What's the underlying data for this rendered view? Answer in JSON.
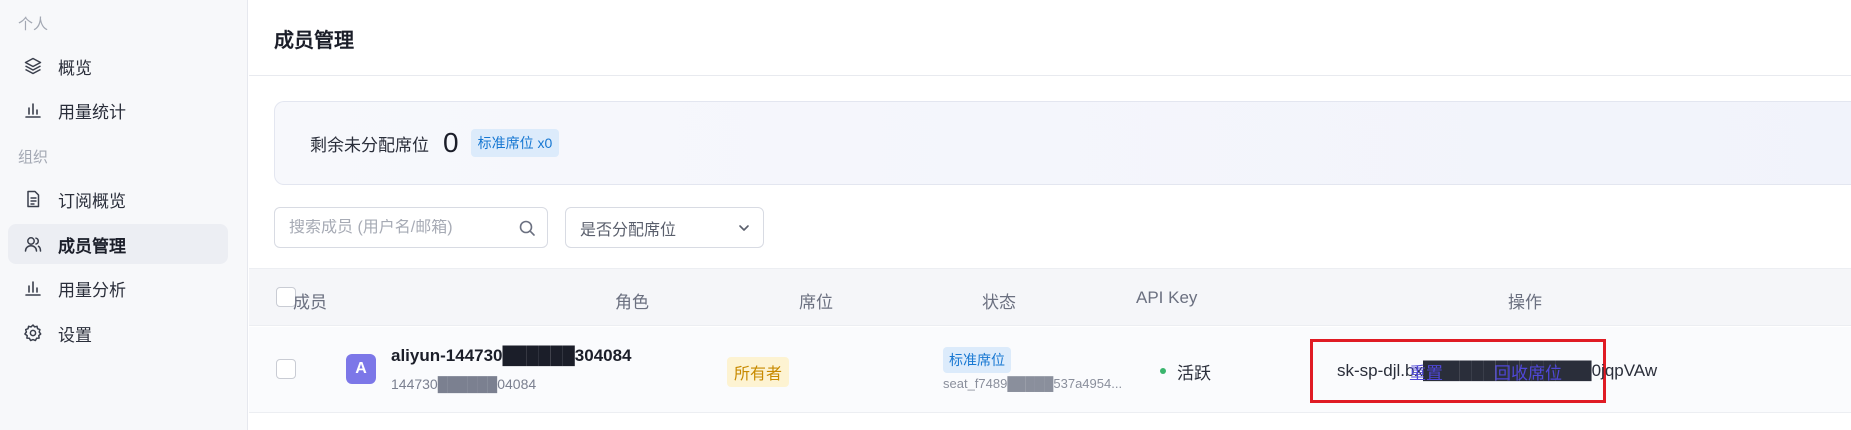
{
  "sidebar": {
    "sections": [
      {
        "label": "个人",
        "items": [
          {
            "label": "概览",
            "icon": "layers-icon"
          },
          {
            "label": "用量统计",
            "icon": "bar-chart-icon"
          }
        ]
      },
      {
        "label": "组织",
        "items": [
          {
            "label": "订阅概览",
            "icon": "document-icon"
          },
          {
            "label": "成员管理",
            "icon": "users-icon",
            "active": true
          },
          {
            "label": "用量分析",
            "icon": "bar-chart-icon"
          },
          {
            "label": "设置",
            "icon": "gear-icon"
          }
        ]
      }
    ]
  },
  "main": {
    "title": "成员管理",
    "seats": {
      "label": "剩余未分配席位",
      "count": "0",
      "badge": "标准席位 x0"
    },
    "search": {
      "placeholder": "搜索成员 (用户名/邮箱)"
    },
    "filter": {
      "value": "是否分配席位"
    },
    "table": {
      "headers": {
        "member": "成员",
        "role": "角色",
        "seat": "席位",
        "status": "状态",
        "api_key": "API Key",
        "actions": "操作"
      },
      "rows": [
        {
          "avatar": "A",
          "name": "aliyun-144730██████304084",
          "id": "144730██████04084",
          "role": "所有者",
          "seat_type": "标准席位",
          "seat_id": "seat_f7489█████537a4954...",
          "status": "活跃",
          "api_key": "sk-sp-djl.bx██████████████0jqpVAw",
          "action_reset": "重置",
          "action_reclaim": "回收席位"
        }
      ]
    }
  },
  "colors": {
    "accent": "#4f47d6",
    "highlight_box": "#e01b24",
    "status_active": "#3ab56d",
    "avatar": "#7c77e8"
  }
}
